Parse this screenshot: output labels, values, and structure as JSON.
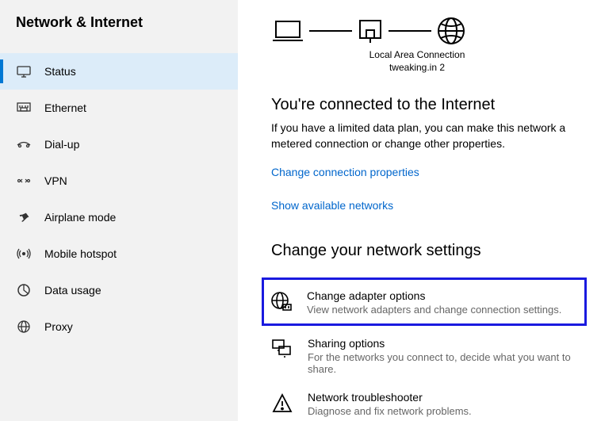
{
  "sidebar": {
    "title": "Network & Internet",
    "items": [
      {
        "label": "Status"
      },
      {
        "label": "Ethernet"
      },
      {
        "label": "Dial-up"
      },
      {
        "label": "VPN"
      },
      {
        "label": "Airplane mode"
      },
      {
        "label": "Mobile hotspot"
      },
      {
        "label": "Data usage"
      },
      {
        "label": "Proxy"
      }
    ]
  },
  "diagram": {
    "caption1": "Local Area Connection",
    "caption2": "tweaking.in 2"
  },
  "status": {
    "headline": "You're connected to the Internet",
    "subtext": "If you have a limited data plan, you can make this network a metered connection or change other properties.",
    "link1": "Change connection properties",
    "link2": "Show available networks"
  },
  "settings": {
    "title": "Change your network settings",
    "options": [
      {
        "title": "Change adapter options",
        "desc": "View network adapters and change connection settings."
      },
      {
        "title": "Sharing options",
        "desc": "For the networks you connect to, decide what you want to share."
      },
      {
        "title": "Network troubleshooter",
        "desc": "Diagnose and fix network problems."
      }
    ]
  }
}
